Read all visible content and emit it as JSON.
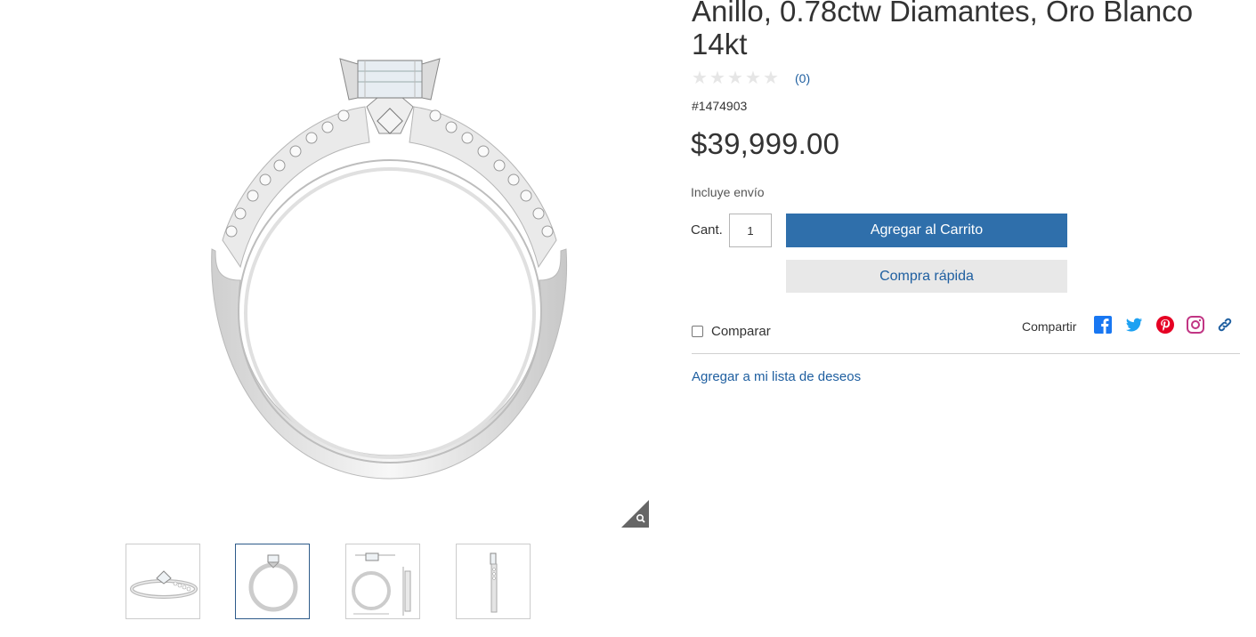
{
  "product": {
    "title": "Anillo, 0.78ctw Diamantes, Oro Blanco 14kt",
    "rating": 0,
    "rating_max": 5,
    "review_count": "(0)",
    "sku": "#1474903",
    "price": "$39,999.00",
    "shipping_note": "Incluye envío"
  },
  "purchase": {
    "qty_label": "Cant.",
    "qty_value": "1",
    "add_to_cart_label": "Agregar al Carrito",
    "quick_buy_label": "Compra rápida"
  },
  "compare": {
    "label": "Comparar",
    "checked": false
  },
  "share": {
    "label": "Compartir",
    "icons": [
      "facebook-icon",
      "twitter-icon",
      "pinterest-icon",
      "instagram-icon",
      "link-icon"
    ]
  },
  "wishlist_label": "Agregar a mi lista de deseos",
  "gallery": {
    "thumbnails": [
      "ring-angle-view",
      "ring-front-view",
      "ring-dimensions-view",
      "ring-side-view"
    ],
    "active_index": 1
  },
  "colors": {
    "primary": "#2f6fab",
    "link": "#1f5fa0",
    "secondary_bg": "#e8e8e8",
    "facebook": "#1877f2",
    "twitter": "#1da1f2",
    "pinterest": "#e60023",
    "instagram": "#c13584"
  }
}
